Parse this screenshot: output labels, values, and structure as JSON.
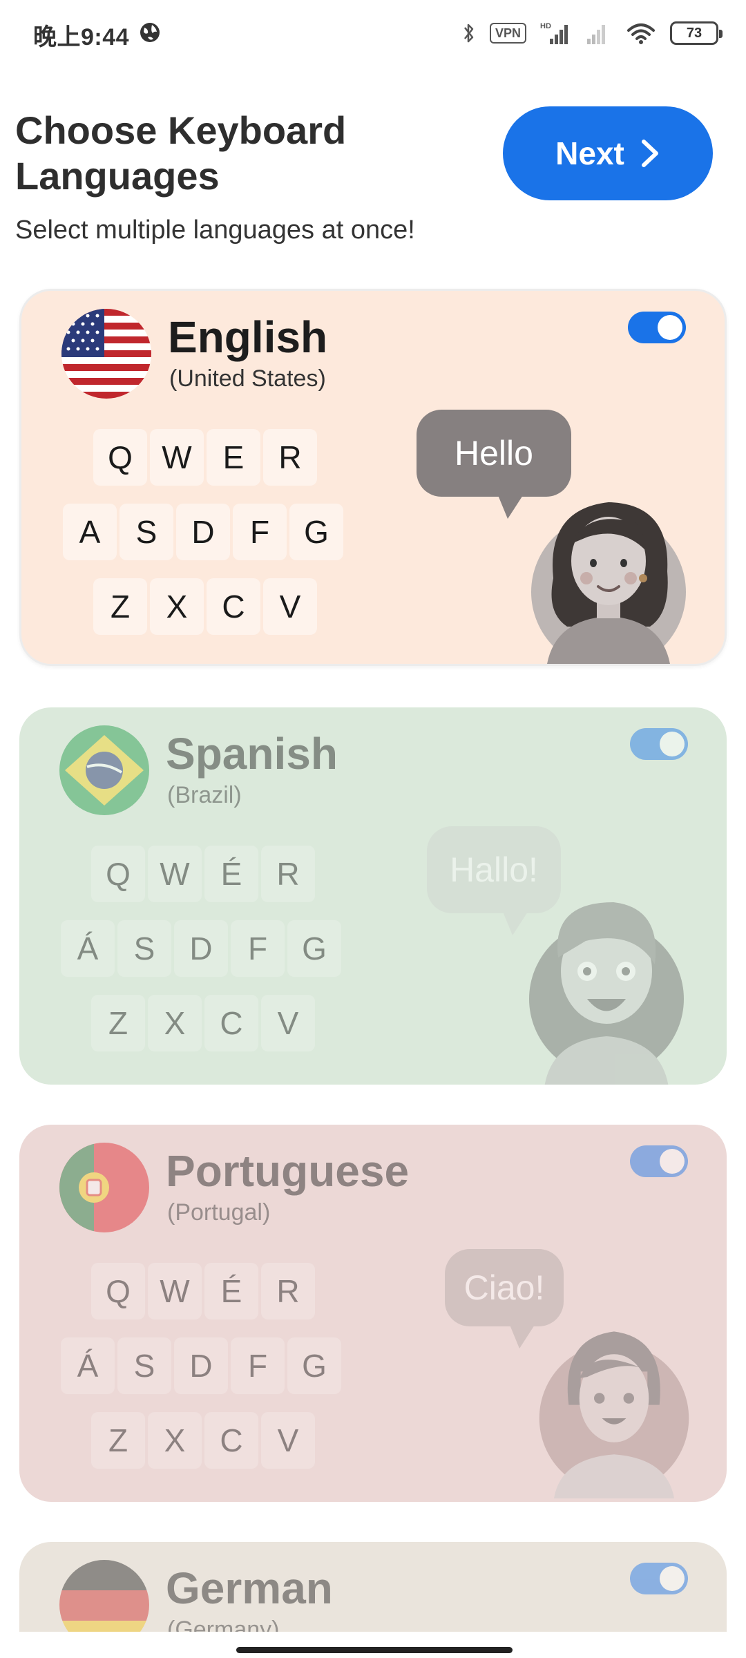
{
  "status_bar": {
    "time": "晚上9:44",
    "vpn_label": "VPN",
    "hd_label": "HD",
    "battery_level": "73"
  },
  "header": {
    "title": "Choose Keyboard Languages",
    "subtitle": "Select multiple languages at once!",
    "next_label": "Next"
  },
  "languages": [
    {
      "name": "English",
      "region": "(United States)",
      "enabled": true,
      "selected": true,
      "greeting": "Hello",
      "keys": [
        [
          "Q",
          "W",
          "E",
          "R"
        ],
        [
          "A",
          "S",
          "D",
          "F",
          "G"
        ],
        [
          "Z",
          "X",
          "C",
          "V"
        ]
      ],
      "background": "#fde9dc"
    },
    {
      "name": "Spanish",
      "region": "(Brazil)",
      "enabled": true,
      "selected": false,
      "greeting": "Hallo!",
      "keys": [
        [
          "Q",
          "W",
          "É",
          "R"
        ],
        [
          "Á",
          "S",
          "D",
          "F",
          "G"
        ],
        [
          "Z",
          "X",
          "C",
          "V"
        ]
      ],
      "background": "#dbe9db"
    },
    {
      "name": "Portuguese",
      "region": "(Portugal)",
      "enabled": true,
      "selected": false,
      "greeting": "Ciao!",
      "keys": [
        [
          "Q",
          "W",
          "É",
          "R"
        ],
        [
          "Á",
          "S",
          "D",
          "F",
          "G"
        ],
        [
          "Z",
          "X",
          "C",
          "V"
        ]
      ],
      "background": "#ecd8d6"
    },
    {
      "name": "German",
      "region": "(Germany)",
      "enabled": true,
      "selected": false,
      "background": "#eae4dc"
    }
  ],
  "colors": {
    "accent": "#1a73e8",
    "speech_bubble": "#868080"
  },
  "icons": {
    "bluetooth": "bluetooth-icon",
    "signal": "signal-icon",
    "wifi": "wifi-icon",
    "globe": "globe-icon",
    "next": "chevron-right-icon"
  }
}
